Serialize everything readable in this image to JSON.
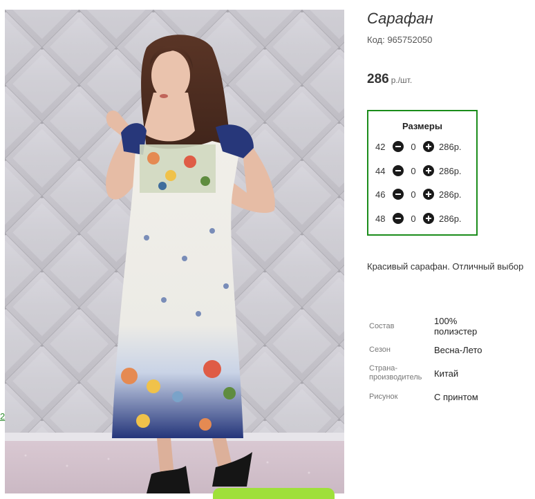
{
  "product": {
    "title": "Сарафан",
    "code": "Код: 965752050",
    "price": "286",
    "price_unit": "р./шт.",
    "description": "Красивый сарафан. Отличный выбор"
  },
  "sizes": {
    "title": "Размеры",
    "rows": [
      {
        "size": "42",
        "qty": "0",
        "price": "286р."
      },
      {
        "size": "44",
        "qty": "0",
        "price": "286р."
      },
      {
        "size": "46",
        "qty": "0",
        "price": "286р."
      },
      {
        "size": "48",
        "qty": "0",
        "price": "286р."
      }
    ]
  },
  "attributes": [
    {
      "key": "Состав",
      "value": "100% полиэстер"
    },
    {
      "key": "Сезон",
      "value": "Весна-Лето"
    },
    {
      "key": "Страна-производитель",
      "value": "Китай"
    },
    {
      "key": "Рисунок",
      "value": "С принтом"
    }
  ],
  "side_link": "2",
  "colors": {
    "sizes_border": "#1a8c1a",
    "button_bg": "#1a1a1a",
    "cta_green": "#9fe03a",
    "link_green": "#2e8b2e"
  },
  "icons": [
    "minus-circle-icon",
    "plus-circle-icon"
  ]
}
